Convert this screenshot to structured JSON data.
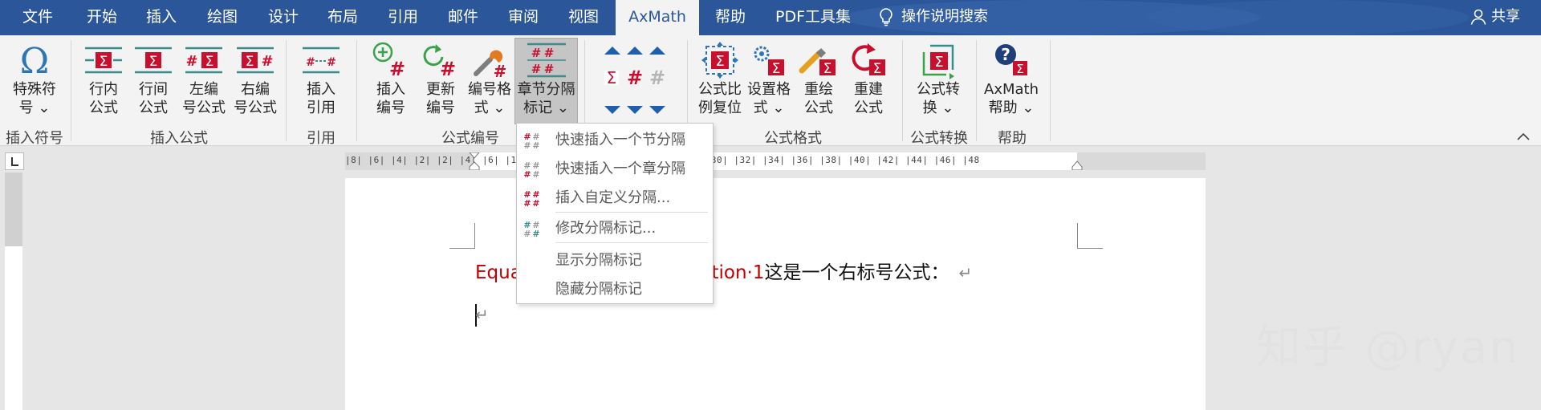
{
  "tabs": [
    {
      "label": "文件"
    },
    {
      "label": "开始"
    },
    {
      "label": "插入"
    },
    {
      "label": "绘图"
    },
    {
      "label": "设计"
    },
    {
      "label": "布局"
    },
    {
      "label": "引用"
    },
    {
      "label": "邮件"
    },
    {
      "label": "审阅"
    },
    {
      "label": "视图"
    },
    {
      "label": "AxMath",
      "active": true
    },
    {
      "label": "帮助"
    },
    {
      "label": "PDF工具集"
    }
  ],
  "tell_me": "操作说明搜索",
  "share": "共享",
  "ribbon": {
    "groups": [
      {
        "label": "插入符号",
        "buttons": [
          {
            "label": "特殊符\n号 ⌄",
            "icon": "omega-icon"
          }
        ]
      },
      {
        "label": "插入公式",
        "buttons": [
          {
            "label": "行内\n公式",
            "icon": "inline-formula-icon"
          },
          {
            "label": "行间\n公式",
            "icon": "display-formula-icon"
          },
          {
            "label": "左编\n号公式",
            "icon": "left-numbered-formula-icon"
          },
          {
            "label": "右编\n号公式",
            "icon": "right-numbered-formula-icon"
          }
        ]
      },
      {
        "label": "引用",
        "buttons": [
          {
            "label": "插入\n引用",
            "icon": "insert-reference-icon"
          }
        ]
      },
      {
        "label": "公式编号",
        "buttons": [
          {
            "label": "插入\n编号",
            "icon": "insert-number-icon"
          },
          {
            "label": "更新\n编号",
            "icon": "update-number-icon"
          },
          {
            "label": "编号格\n式 ⌄",
            "icon": "number-format-icon"
          },
          {
            "label": "章节分隔\n标记 ⌄",
            "icon": "section-break-icon",
            "pressed": true
          }
        ]
      },
      {
        "label": "",
        "buttons": [
          {
            "label": "",
            "icon": "alignment-grid-icon"
          }
        ]
      },
      {
        "label": "公式格式",
        "buttons": [
          {
            "label": "公式比\n例复位",
            "icon": "formula-scale-reset-icon"
          },
          {
            "label": "设置格\n式 ⌄",
            "icon": "format-settings-icon"
          },
          {
            "label": "重绘\n公式",
            "icon": "redraw-formula-icon"
          },
          {
            "label": "重建\n公式",
            "icon": "rebuild-formula-icon"
          }
        ]
      },
      {
        "label": "公式转换",
        "buttons": [
          {
            "label": "公式转\n换 ⌄",
            "icon": "formula-convert-icon"
          }
        ]
      },
      {
        "label": "帮助",
        "buttons": [
          {
            "label": "AxMath\n帮助 ⌄",
            "icon": "help-icon"
          }
        ]
      }
    ]
  },
  "ruler": {
    "numbers": "|8|  |6|  |4|  |2|         |2|          |4|  |6|         |16|  |18|  |20|  |22|  |24|  |26|  |28|  |30|  |32|  |34|  |36|  |38|  |40|  |42|  |44|  |46|  |48"
  },
  "menu": {
    "items": [
      {
        "label": "快速插入一个节分隔",
        "icon": "section-break-small-icon"
      },
      {
        "label": "快速插入一个章分隔",
        "icon": "chapter-break-small-icon"
      },
      {
        "label": "插入自定义分隔...",
        "icon": "custom-break-small-icon"
      },
      {
        "label": "修改分隔标记...",
        "icon": "modify-break-small-icon"
      },
      {
        "label": "显示分隔标记",
        "icon": ""
      },
      {
        "label": "隐藏分隔标记",
        "icon": ""
      }
    ]
  },
  "document": {
    "line1_red_start": "Equa",
    "line1_red_end": "ction·1",
    "line1_text": "这是一个右标号公式：",
    "paragraph_mark": "↵"
  },
  "watermark": "知乎 @ryan",
  "colors": {
    "tabbar": "#2b579a",
    "ribbon": "#f3f3f3",
    "equation_red": "#c00000",
    "icon_red": "#c8102e",
    "icon_teal": "#3a8c8c"
  }
}
